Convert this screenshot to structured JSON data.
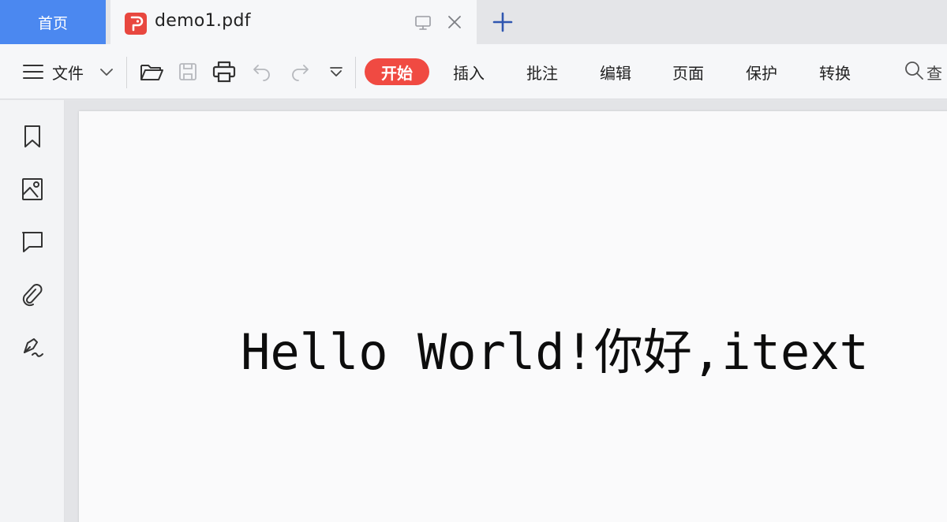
{
  "tabs": {
    "home_label": "首页",
    "document_name": "demo1.pdf"
  },
  "toolbar": {
    "file_label": "文件",
    "nav_tabs": [
      {
        "label": "开始",
        "active": true
      },
      {
        "label": "插入"
      },
      {
        "label": "批注"
      },
      {
        "label": "编辑"
      },
      {
        "label": "页面"
      },
      {
        "label": "保护"
      },
      {
        "label": "转换"
      }
    ],
    "search_label": "查"
  },
  "sidebar": {
    "icons": [
      "bookmark-icon",
      "image-icon",
      "comment-icon",
      "attachment-icon",
      "signature-icon"
    ]
  },
  "document": {
    "page_text": "Hello World!你好,itext"
  },
  "colors": {
    "home_tab": "#4b88f0",
    "accent_red": "#f04a42",
    "new_tab_plus": "#2f56b0"
  }
}
